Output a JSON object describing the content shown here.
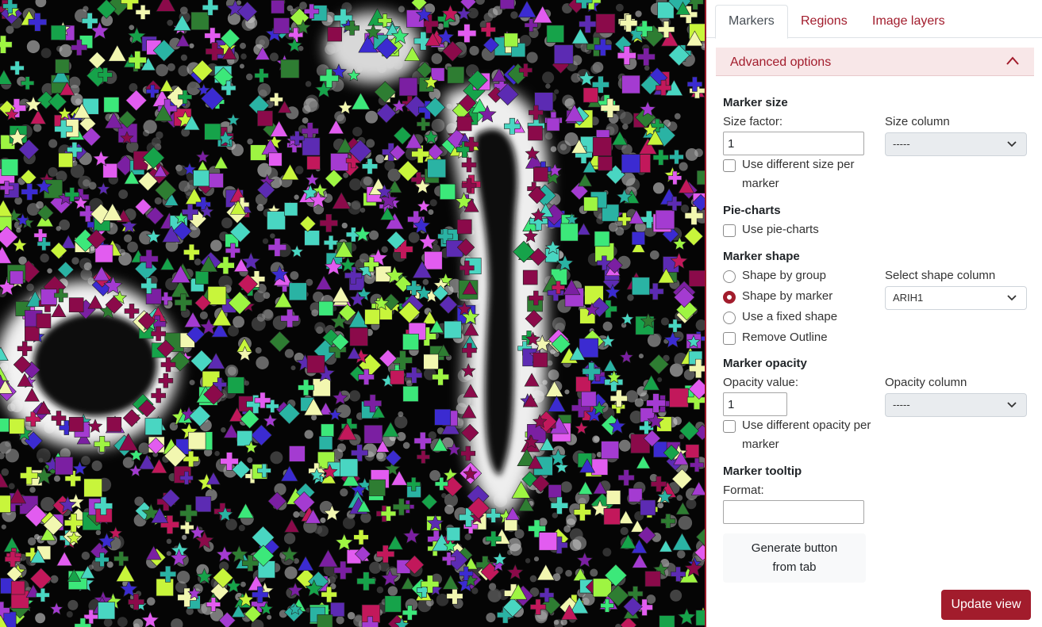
{
  "tabs": [
    {
      "label": "Markers",
      "active": true
    },
    {
      "label": "Regions",
      "active": false
    },
    {
      "label": "Image layers",
      "active": false
    }
  ],
  "accordion": {
    "title": "Advanced options",
    "expanded": true,
    "chevron_icon": "chevron-up-icon"
  },
  "marker_size": {
    "title": "Marker size",
    "size_factor_label": "Size factor:",
    "size_factor_value": "1",
    "size_column_label": "Size column",
    "size_column_value": "-----",
    "different_size_label": "Use different size per marker",
    "different_size_checked": false
  },
  "pie_charts": {
    "title": "Pie-charts",
    "use_label": "Use pie-charts",
    "checked": false
  },
  "marker_shape": {
    "title": "Marker shape",
    "options": [
      {
        "label": "Shape by group",
        "checked": false
      },
      {
        "label": "Shape by marker",
        "checked": true
      },
      {
        "label": "Use a fixed shape",
        "checked": false
      }
    ],
    "remove_outline_label": "Remove Outline",
    "remove_outline_checked": false,
    "select_column_label": "Select shape column",
    "select_column_value": "ARIH1"
  },
  "marker_opacity": {
    "title": "Marker opacity",
    "value_label": "Opacity value:",
    "value": "1",
    "column_label": "Opacity column",
    "column_value": "-----",
    "different_label": "Use different opacity per marker",
    "different_checked": false
  },
  "marker_tooltip": {
    "title": "Marker tooltip",
    "format_label": "Format:",
    "format_value": ""
  },
  "buttons": {
    "generate_label": "Generate button from tab",
    "update_label": "Update view"
  },
  "colors": {
    "accent": "#a21c2c",
    "accordion_bg": "#f8e7e8",
    "marker_palette": [
      "#c8f53b",
      "#9ef542",
      "#3ce87a",
      "#49d6c2",
      "#2ab3a4",
      "#7b1fa2",
      "#a43bd1",
      "#e25cf0",
      "#8b0a4a",
      "#c2185b",
      "#3b2bd1",
      "#5c2bb3",
      "#2e7d32",
      "#16a34a",
      "#f2f7b0"
    ]
  }
}
